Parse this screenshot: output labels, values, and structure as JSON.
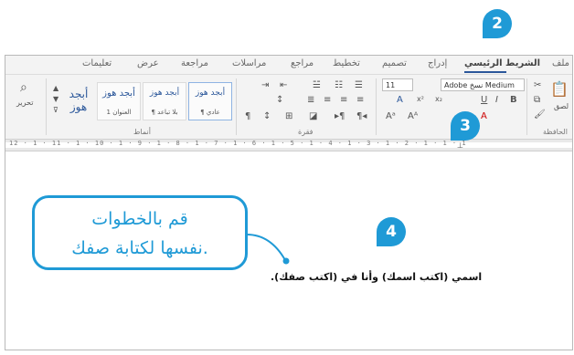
{
  "tabs": {
    "file": "ملف",
    "home": "الشريط الرئيسي",
    "insert": "إدراج",
    "design": "تصميم",
    "layout": "تخطيط",
    "references": "مراجع",
    "mailings": "مراسلات",
    "review": "مراجعة",
    "view": "عرض",
    "help": "تعليمات"
  },
  "ribbon": {
    "font_name": "Adobe نسخ Medium",
    "font_size": "11",
    "group_labels": {
      "clipboard": "الحافظة",
      "paragraph": "فقرة",
      "styles": "أنماط"
    },
    "styles": [
      {
        "preview": "أبجد هوز",
        "name": "¶ عادي"
      },
      {
        "preview": "أبجد هوز",
        "name": "¶ بلا تباعد"
      },
      {
        "preview": "أبجد هوز",
        "name": "العنوان 1"
      }
    ],
    "big_style": "أبجد هوز",
    "edit_label": "تحرير",
    "paste_label": "لصق"
  },
  "ruler": {
    "text": "12 · 1 · 11 · 1 · 10 · 1 · 9 · 1 · 8 · 1 · 7 · 1 · 6 · 1 · 5 · 1 · 4 · 1 · 3 · 1 · 2 · 1 · 1 · 1"
  },
  "badges": {
    "two": "2",
    "three": "3",
    "four": "4"
  },
  "callout": {
    "line1": "قم بالخطوات",
    "line2": "نفسها لكتابة صفك."
  },
  "document": {
    "text": "اسمي (اكتب اسمك) وأنا في (اكتب صفك)."
  },
  "colors": {
    "accent": "#1f9ad6",
    "word_blue": "#2b579a"
  }
}
